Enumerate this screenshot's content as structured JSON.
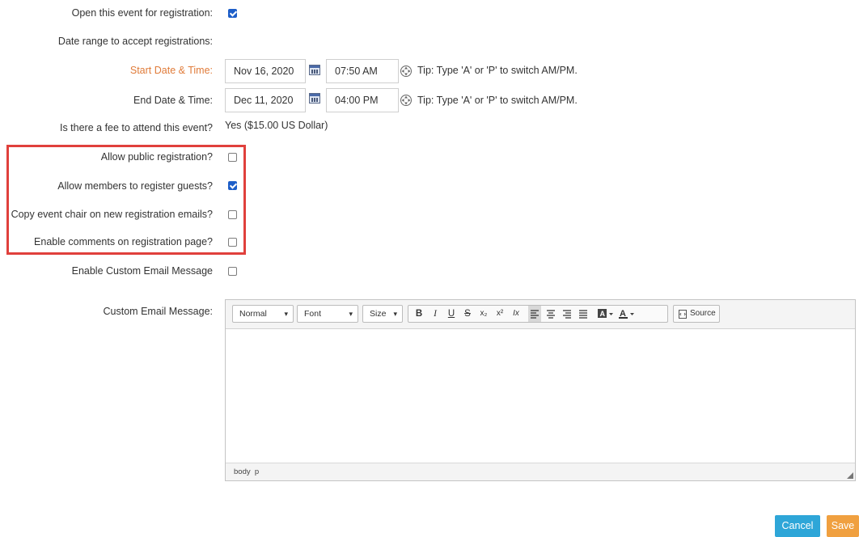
{
  "form": {
    "open_registration": {
      "label": "Open this event for registration:",
      "checked": true
    },
    "date_range_label": "Date range to accept registrations:",
    "start": {
      "label": "Start Date & Time:",
      "date": "Nov 16, 2020",
      "time": "07:50 AM",
      "tip": "Tip: Type 'A' or 'P' to switch AM/PM."
    },
    "end": {
      "label": "End Date & Time:",
      "date": "Dec 11, 2020",
      "time": "04:00 PM",
      "tip": "Tip: Type 'A' or 'P' to switch AM/PM."
    },
    "fee": {
      "label": "Is there a fee to attend this event?",
      "value": "Yes ($15.00 US Dollar)"
    },
    "allow_public": {
      "label": "Allow public registration?",
      "checked": false
    },
    "allow_guests": {
      "label": "Allow members to register guests?",
      "checked": true
    },
    "copy_chair": {
      "label": "Copy event chair on new registration emails?",
      "checked": false
    },
    "enable_comments": {
      "label": "Enable comments on registration page?",
      "checked": false
    },
    "enable_custom_email": {
      "label": "Enable Custom Email Message",
      "checked": false
    },
    "custom_email_label": "Custom Email Message:"
  },
  "editor": {
    "format_combo": "Normal",
    "font_combo": "Font",
    "size_combo": "Size",
    "buttons": {
      "bold": "B",
      "italic": "I",
      "underline": "U",
      "strike": "S",
      "subscript": "x₂",
      "superscript": "x²",
      "remove_format": "Ix"
    },
    "source_label": "Source",
    "status_path": "body  p"
  },
  "actions": {
    "cancel": "Cancel",
    "save": "Save"
  },
  "colors": {
    "accent_orange": "#f0a040",
    "cancel_blue": "#2ea6d8",
    "highlight_red": "#e0403c",
    "label_orange": "#e07b39"
  }
}
